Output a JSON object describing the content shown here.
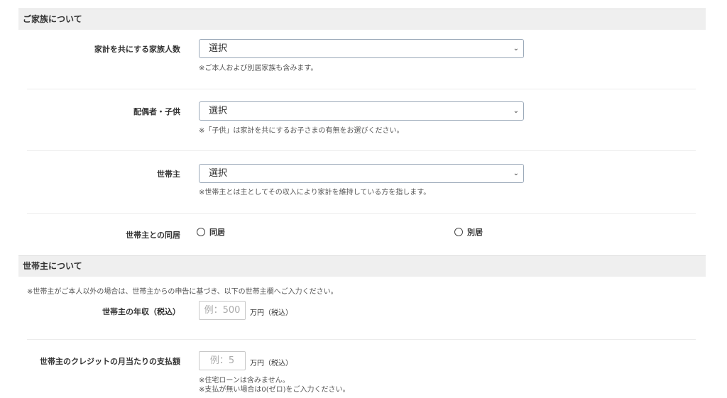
{
  "sections": {
    "family": {
      "title": "ご家族について"
    },
    "householder": {
      "title": "世帯主について"
    }
  },
  "family": {
    "household_size": {
      "label": "家計を共にする家族人数",
      "value": "選択",
      "note": "※ご本人および別居家族も含みます。"
    },
    "spouse_child": {
      "label": "配偶者・子供",
      "value": "選択",
      "note": "※「子供」は家計を共にするお子さまの有無をお選びください。"
    },
    "householder": {
      "label": "世帯主",
      "value": "選択",
      "note": "※世帯主とは主としてその収入により家計を維持している方を指します。"
    },
    "cohabitation": {
      "label": "世帯主との同居",
      "options": [
        "同居",
        "別居"
      ]
    }
  },
  "householder": {
    "intro_note": "※世帯主がご本人以外の場合は、世帯主からの申告に基づき、以下の世帯主欄へご入力ください。",
    "income": {
      "label": "世帯主の年収（税込）",
      "placeholder": "例：500",
      "unit": "万円（税込）"
    },
    "credit_payment": {
      "label": "世帯主のクレジットの月当たりの支払額",
      "placeholder": "例：5",
      "unit": "万円（税込）",
      "notes": [
        "※住宅ローンは含みません。",
        "※支払が無い場合は0(ゼロ)をご入力ください。"
      ]
    }
  },
  "icons": {
    "select_chevron": "chevron-down-icon",
    "radio": "radio-unchecked-icon"
  }
}
